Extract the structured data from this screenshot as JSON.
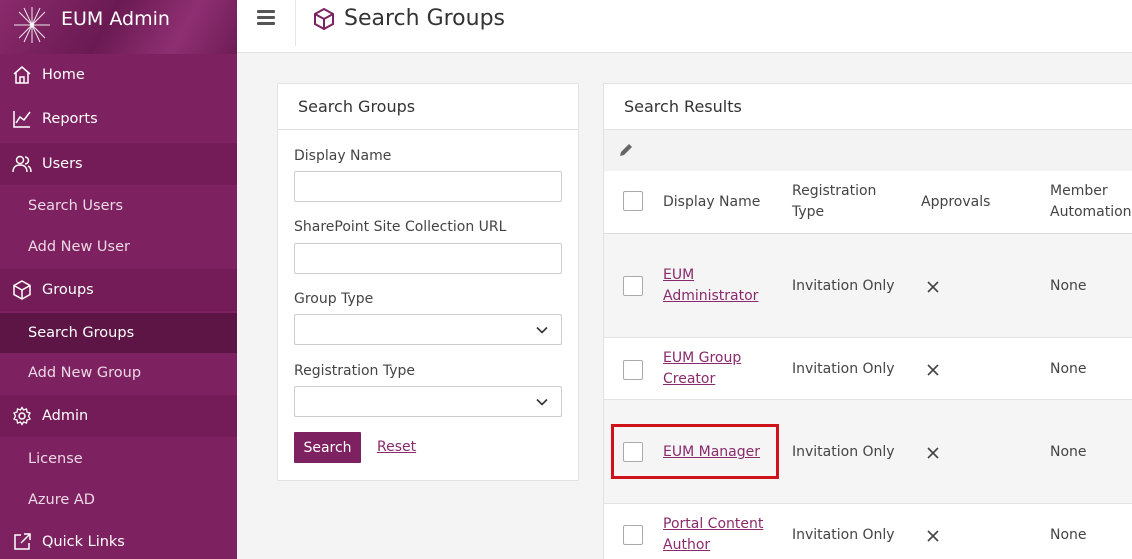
{
  "app": {
    "title": "EUM Admin"
  },
  "sidebar": {
    "home": "Home",
    "reports": "Reports",
    "users": "Users",
    "search_users": "Search Users",
    "add_new_user": "Add New User",
    "groups": "Groups",
    "search_groups": "Search Groups",
    "add_new_group": "Add New Group",
    "admin": "Admin",
    "license": "License",
    "azure_ad": "Azure AD",
    "quick_links": "Quick Links"
  },
  "header": {
    "title": "Search Groups"
  },
  "search_form": {
    "title": "Search Groups",
    "display_name_label": "Display Name",
    "display_name_value": "",
    "sharepoint_url_label": "SharePoint Site Collection URL",
    "sharepoint_url_value": "",
    "group_type_label": "Group Type",
    "group_type_value": "",
    "registration_type_label": "Registration Type",
    "registration_type_value": "",
    "search_button": "Search",
    "reset_link": "Reset"
  },
  "results": {
    "title": "Search Results",
    "columns": {
      "display_name": "Display Name",
      "registration_type_1": "Registration",
      "registration_type_2": "Type",
      "approvals": "Approvals",
      "member_automation_1": "Member",
      "member_automation_2": "Automation"
    },
    "rows": [
      {
        "name_1": "EUM",
        "name_2": "Administrator",
        "registration": "Invitation Only",
        "approvals": "x",
        "automation": "None"
      },
      {
        "name_1": "EUM Group",
        "name_2": "Creator",
        "registration": "Invitation Only",
        "approvals": "x",
        "automation": "None"
      },
      {
        "name_1": "EUM Manager",
        "name_2": "",
        "registration": "Invitation Only",
        "approvals": "x",
        "automation": "None"
      },
      {
        "name_1": "Portal Content",
        "name_2": "Author",
        "registration": "Invitation Only",
        "approvals": "x",
        "automation": "None"
      }
    ]
  },
  "colors": {
    "brand": "#7e2160",
    "link": "#8a2a6c",
    "highlight": "#d0121b"
  }
}
